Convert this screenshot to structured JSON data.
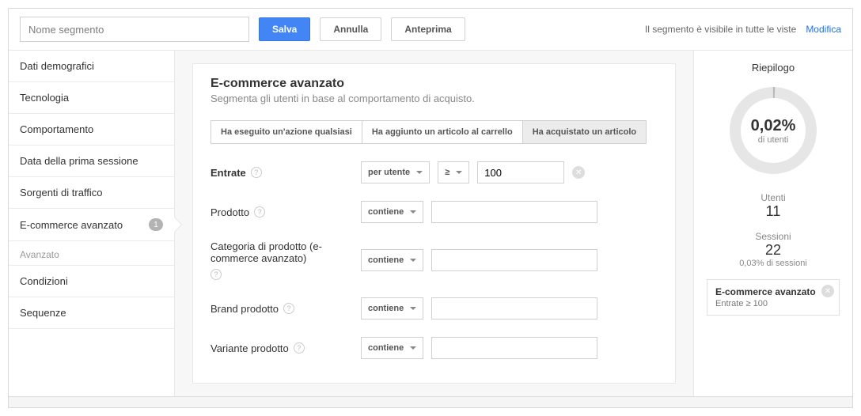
{
  "topbar": {
    "seg_placeholder": "Nome segmento",
    "save": "Salva",
    "cancel": "Annulla",
    "preview": "Anteprima",
    "visibility_text": "Il segmento è visibile in tutte le viste",
    "change_link": "Modifica"
  },
  "sidebar": {
    "items": [
      {
        "label": "Dati demografici"
      },
      {
        "label": "Tecnologia"
      },
      {
        "label": "Comportamento"
      },
      {
        "label": "Data della prima sessione"
      },
      {
        "label": "Sorgenti di traffico"
      },
      {
        "label": "E-commerce avanzato",
        "badge": "1",
        "active": true
      }
    ],
    "advanced_header": "Avanzato",
    "adv_items": [
      {
        "label": "Condizioni"
      },
      {
        "label": "Sequenze"
      }
    ]
  },
  "main": {
    "title": "E-commerce avanzato",
    "subtitle": "Segmenta gli utenti in base al comportamento di acquisto.",
    "tabs": [
      {
        "label": "Ha eseguito un'azione qualsiasi"
      },
      {
        "label": "Ha aggiunto un articolo al carrello"
      },
      {
        "label": "Ha acquistato un articolo",
        "active": true
      }
    ],
    "rows": {
      "revenue": {
        "label": "Entrate",
        "scope": "per utente",
        "op": "≥",
        "value": "100"
      },
      "product": {
        "label": "Prodotto",
        "op": "contiene"
      },
      "category": {
        "label": "Categoria di prodotto (e-commerce avanzato)",
        "op": "contiene"
      },
      "brand": {
        "label": "Brand prodotto",
        "op": "contiene"
      },
      "variant": {
        "label": "Variante prodotto",
        "op": "contiene"
      }
    }
  },
  "summary": {
    "title": "Riepilogo",
    "donut_pct": "0,02%",
    "donut_sub": "di utenti",
    "users_label": "Utenti",
    "users_value": "11",
    "sessions_label": "Sessioni",
    "sessions_value": "22",
    "sessions_sub": "0,03% di sessioni",
    "filter_title": "E-commerce avanzato",
    "filter_desc": "Entrate ≥ 100"
  }
}
